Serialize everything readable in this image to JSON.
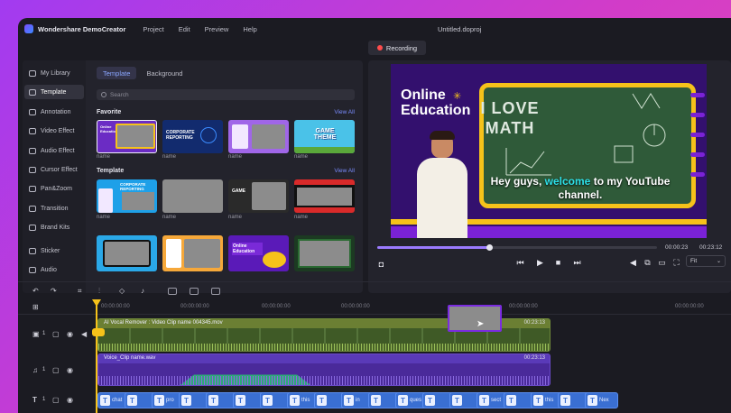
{
  "app": {
    "name": "Wondershare DemoCreator",
    "menus": [
      "Project",
      "Edit",
      "Preview",
      "Help"
    ],
    "document": "Untitled.doproj",
    "record_label": "Recording"
  },
  "sidebar": {
    "items": [
      {
        "label": "My Library",
        "icon": "library-icon"
      },
      {
        "label": "Template",
        "icon": "template-icon",
        "active": true
      },
      {
        "label": "Annotation",
        "icon": "annotation-icon"
      },
      {
        "label": "Video Effect",
        "icon": "video-effect-icon"
      },
      {
        "label": "Audio Effect",
        "icon": "audio-effect-icon"
      },
      {
        "label": "Cursor Effect",
        "icon": "cursor-effect-icon"
      },
      {
        "label": "Pan&Zoom",
        "icon": "pan-zoom-icon"
      },
      {
        "label": "Transition",
        "icon": "transition-icon"
      },
      {
        "label": "Brand Kits",
        "icon": "brand-kits-icon"
      },
      {
        "label": "Sticker",
        "icon": "sticker-icon"
      },
      {
        "label": "Audio",
        "icon": "audio-icon"
      }
    ]
  },
  "library": {
    "tabs": [
      "Template",
      "Background"
    ],
    "search_placeholder": "Search",
    "favorite": {
      "title": "Favorite",
      "view_all": "View All",
      "items": [
        {
          "name": "name",
          "text": "Online Education"
        },
        {
          "name": "name",
          "text": "CORPORATE REPORTING"
        },
        {
          "name": "name",
          "text": ""
        },
        {
          "name": "name",
          "text": "GAME THEME"
        }
      ]
    },
    "template": {
      "title": "Template",
      "view_all": "View All",
      "items": [
        {
          "name": "name",
          "text": "CORPORATE REPORTING"
        },
        {
          "name": "name",
          "text": ""
        },
        {
          "name": "name",
          "text": "GAME"
        },
        {
          "name": "name",
          "text": ""
        },
        {
          "name": "",
          "text": ""
        },
        {
          "name": "",
          "text": ""
        },
        {
          "name": "",
          "text": "Online Education"
        },
        {
          "name": "",
          "text": ""
        }
      ]
    }
  },
  "preview": {
    "title_line1": "Online",
    "title_line2": "Education",
    "board_line1": "I LOVE",
    "board_line2": "MATH",
    "subtitle_pre": "Hey guys, ",
    "subtitle_highlight": "welcome",
    "subtitle_post": " to my YouTube channel.",
    "current_time": "00:00:23",
    "total_time": "00:23:12",
    "fit": "Fit",
    "progress": 0.4
  },
  "timeline": {
    "ruler": [
      "00:00:00:00",
      "00:00:00:00",
      "00:00:00:00",
      "00:00:00:00",
      "00:00:00:00",
      "00:00:00:00"
    ],
    "tracks": [
      {
        "index": "1"
      },
      {
        "index": "1"
      },
      {
        "index": "1"
      }
    ],
    "video_clip": {
      "label": "AI Vocal Remover : Video Clip name 004345.mov",
      "duration": "00:23:13"
    },
    "audio_clip": {
      "label": "Voice_Clip name.wav",
      "duration": "00:23:13"
    },
    "text_clips": [
      "chat",
      "",
      "pro",
      "",
      "",
      "",
      "",
      "this",
      "",
      "in",
      "",
      "ques",
      "",
      "",
      "sect",
      "",
      "this",
      "",
      "Nex"
    ]
  },
  "colors": {
    "accent": "#f6c21a",
    "clip_video": "#5a7a2e",
    "clip_audio": "#5a2cae",
    "clip_text": "#3a6fd2",
    "highlight": "#2de0e8"
  }
}
